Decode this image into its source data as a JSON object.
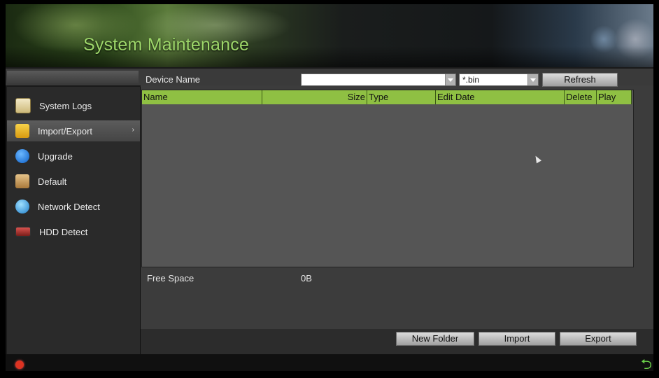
{
  "window": {
    "title": "System Maintenance"
  },
  "sidebar": {
    "items": [
      {
        "label": "System Logs",
        "icon": "log-icon",
        "active": false
      },
      {
        "label": "Import/Export",
        "icon": "folder-icon",
        "active": true
      },
      {
        "label": "Upgrade",
        "icon": "upgrade-icon",
        "active": false
      },
      {
        "label": "Default",
        "icon": "box-icon",
        "active": false
      },
      {
        "label": "Network Detect",
        "icon": "globe-icon",
        "active": false
      },
      {
        "label": "HDD Detect",
        "icon": "hdd-icon",
        "active": false
      }
    ]
  },
  "device": {
    "label": "Device Name",
    "value": "",
    "filter_value": "*.bin",
    "refresh_label": "Refresh"
  },
  "table": {
    "columns": [
      "Name",
      "Size",
      "Type",
      "Edit Date",
      "Delete",
      "Play"
    ],
    "rows": []
  },
  "storage": {
    "free_space_label": "Free Space",
    "free_space_value": "0B"
  },
  "actions": {
    "new_folder": "New Folder",
    "import": "Import",
    "export": "Export"
  },
  "colors": {
    "accent_green": "#8fc043",
    "title_green": "#9ed86a",
    "power_red": "#dd3322"
  }
}
